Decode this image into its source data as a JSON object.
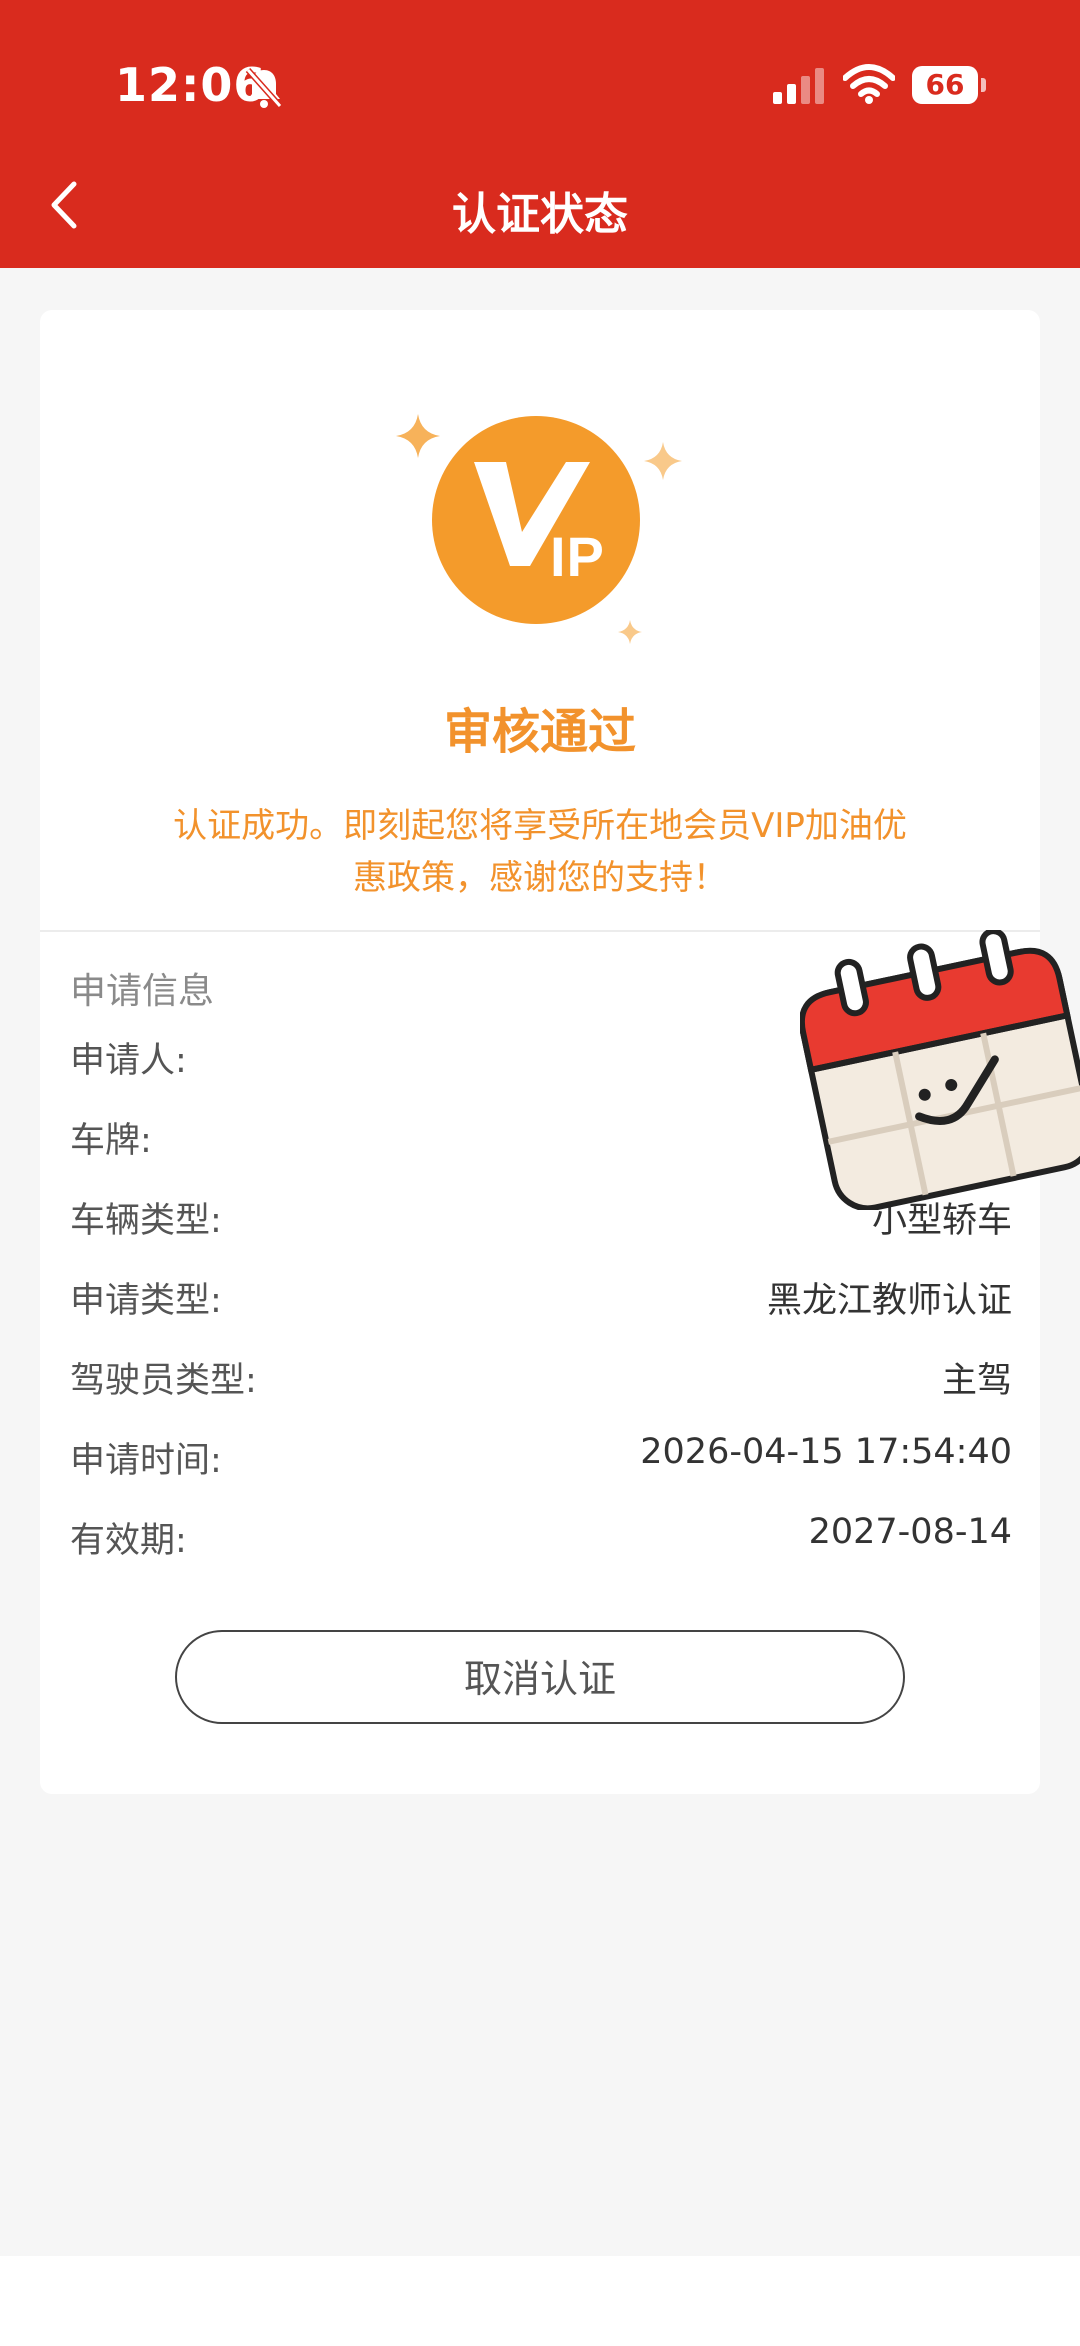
{
  "status_bar": {
    "time": "12:06",
    "battery": "66"
  },
  "nav": {
    "title": "认证状态"
  },
  "result": {
    "title": "审核通过",
    "desc_line1": "认证成功。即刻起您将享受所在地会员VIP加油优",
    "desc_line2": "惠政策，感谢您的支持！",
    "vip_letters": "IP",
    "accent_color": "#f49b2b"
  },
  "info": {
    "section_title": "申请信息",
    "rows": [
      {
        "label": "申请人:",
        "value": ""
      },
      {
        "label": "车牌:",
        "value": ""
      },
      {
        "label": "车辆类型:",
        "value": "小型轿车"
      },
      {
        "label": "申请类型:",
        "value": "黑龙江教师认证"
      },
      {
        "label": "驾驶员类型:",
        "value": "主驾"
      },
      {
        "label": "申请时间:",
        "value": "2026-04-15 17:54:40"
      },
      {
        "label": "有效期:",
        "value": "2027-08-14"
      }
    ]
  },
  "actions": {
    "cancel_label": "取消认证"
  },
  "colors": {
    "header": "#d92b1e",
    "accent": "#f2922c"
  }
}
